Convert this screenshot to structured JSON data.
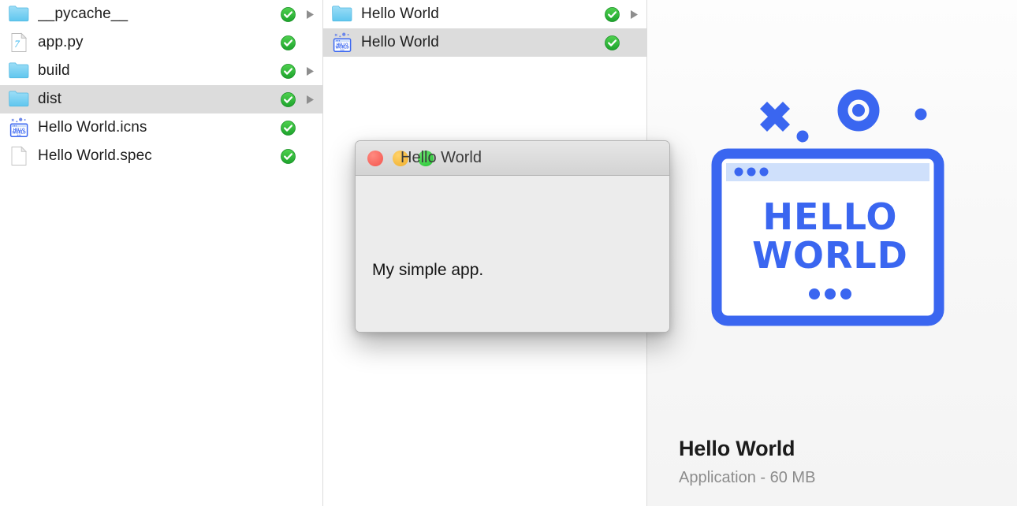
{
  "window": {
    "title": "Hello World"
  },
  "colors": {
    "folder_blue": "#73d0f4",
    "badge_green": "#27b33a",
    "selected_row": "#dcdcdc",
    "icon_blue": "#3a66f0",
    "divider": "#dcdcdc",
    "traffic_red": "#f4554e",
    "traffic_yellow": "#f0ae2b",
    "traffic_green": "#21c32f"
  },
  "columns": [
    {
      "name": "project-column",
      "rows": [
        {
          "label": "__pycache__",
          "icon": "folder-icon",
          "badge": "sync-check-badge",
          "disclosure": true,
          "selected": false
        },
        {
          "label": "app.py",
          "icon": "python-file-icon",
          "badge": "sync-check-badge",
          "disclosure": false,
          "selected": false
        },
        {
          "label": "build",
          "icon": "folder-icon",
          "badge": "sync-check-badge",
          "disclosure": true,
          "selected": false
        },
        {
          "label": "dist",
          "icon": "folder-icon",
          "badge": "sync-check-badge",
          "disclosure": true,
          "selected": true
        },
        {
          "label": "Hello World.icns",
          "icon": "icns-file-icon",
          "badge": "sync-check-badge",
          "disclosure": false,
          "selected": false
        },
        {
          "label": "Hello World.spec",
          "icon": "plain-file-icon",
          "badge": "sync-check-badge",
          "disclosure": false,
          "selected": false
        }
      ]
    },
    {
      "name": "dist-column",
      "rows": [
        {
          "label": "Hello World",
          "icon": "folder-icon",
          "badge": "sync-check-badge",
          "disclosure": true,
          "selected": false
        },
        {
          "label": "Hello World",
          "icon": "icns-file-icon",
          "badge": "sync-check-badge",
          "disclosure": false,
          "selected": true
        }
      ]
    }
  ],
  "preview": {
    "icon_name": "hello-world-app-icon",
    "icon_text_line1": "HELLO",
    "icon_text_line2": "WORLD",
    "title": "Hello World",
    "subtitle": "Application - 60 MB"
  },
  "app_window": {
    "title": "Hello World",
    "body_text": "My simple app.",
    "close_label": "Close",
    "minimize_label": "Minimize",
    "zoom_label": "Zoom"
  }
}
